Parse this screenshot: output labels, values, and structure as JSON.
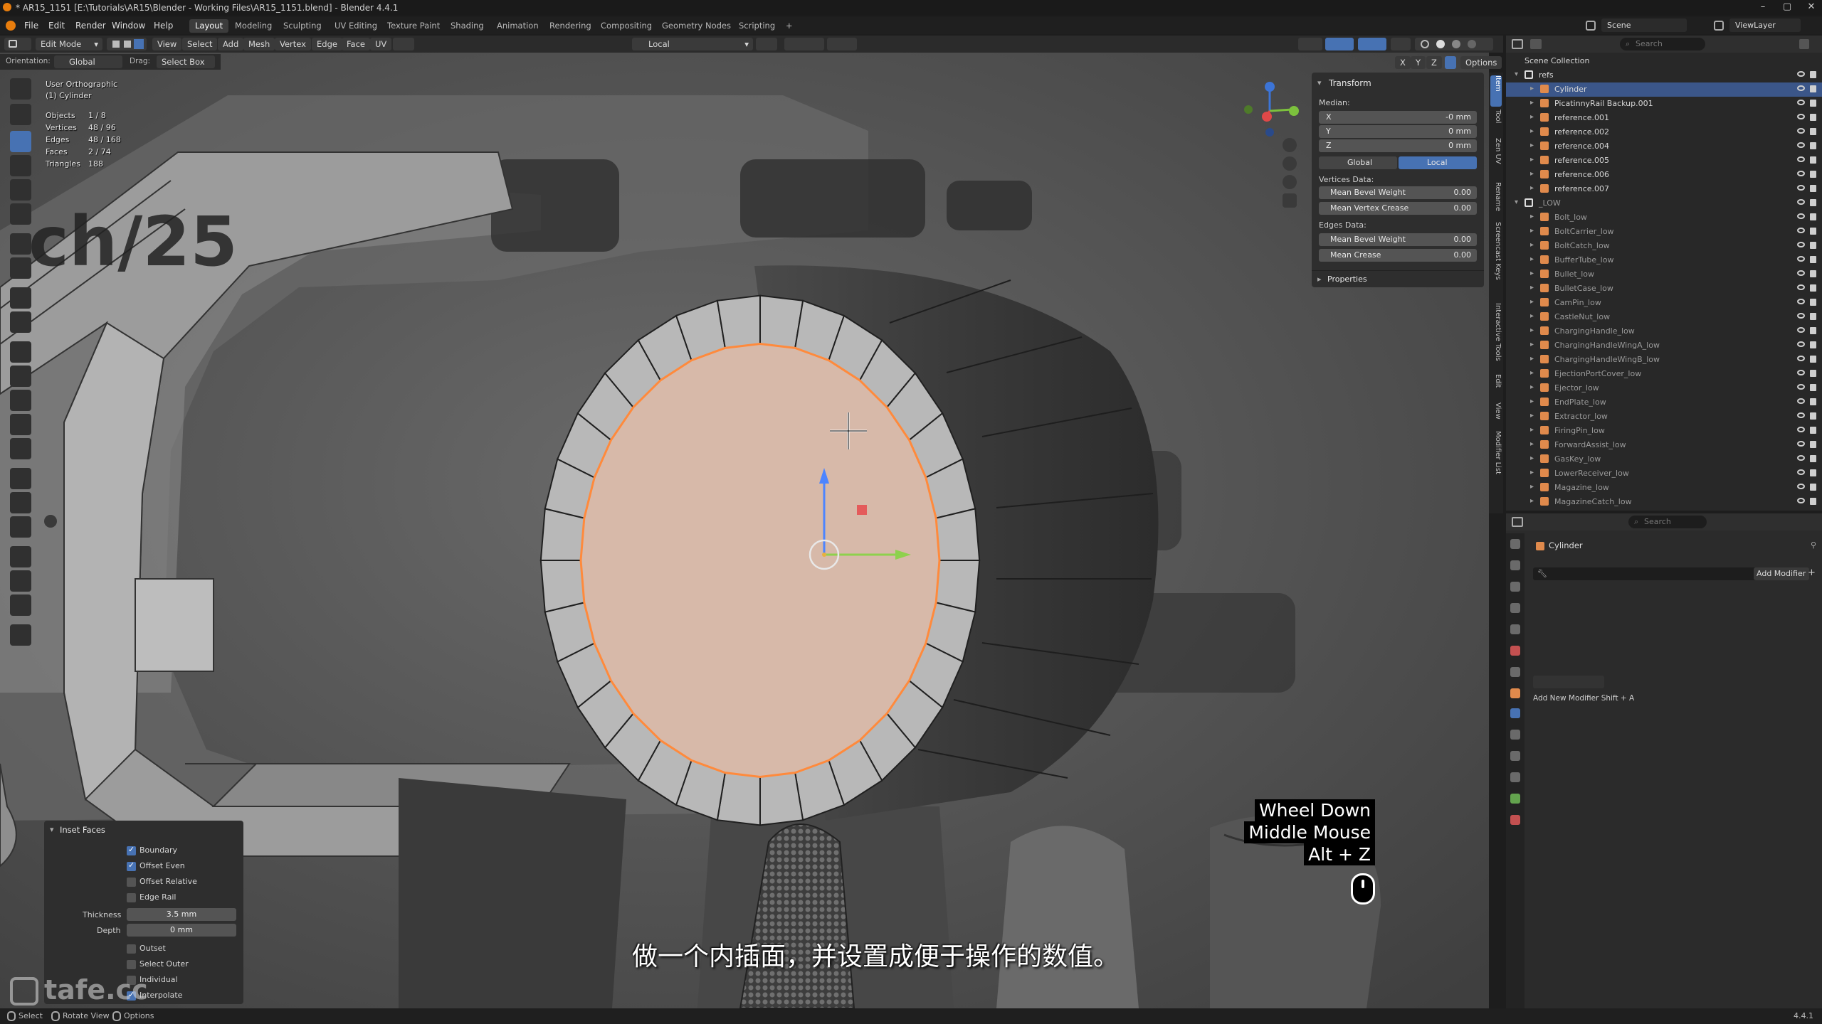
{
  "window": {
    "title": "* AR15_1151 [E:\\Tutorials\\AR15\\Blender - Working Files\\AR15_1151.blend] - Blender 4.4.1",
    "minimize": "–",
    "maximize": "▢",
    "close": "✕"
  },
  "menubar": {
    "items": [
      "File",
      "Edit",
      "Render",
      "Window",
      "Help"
    ],
    "workspaces": [
      "Layout",
      "Modeling",
      "Sculpting",
      "UV Editing",
      "Texture Paint",
      "Shading",
      "Animation",
      "Rendering",
      "Compositing",
      "Geometry Nodes",
      "Scripting",
      "+"
    ],
    "active_workspace": "Layout",
    "scene": "Scene",
    "view_layer": "ViewLayer"
  },
  "viewport_header": {
    "mode": "Edit Mode",
    "menus": [
      "View",
      "Select",
      "Add",
      "Mesh",
      "Vertex",
      "Edge",
      "Face",
      "UV"
    ],
    "transform_orientation": "Local",
    "orientation_label": "Orientation:",
    "orientation_value": "Global",
    "drag_label": "Drag:",
    "drag_value": "Select Box",
    "axes": [
      "X",
      "Y",
      "Z"
    ],
    "options": "Options"
  },
  "overlay": {
    "view_name": "User Orthographic",
    "object_name": "(1) Cylinder",
    "stats": [
      {
        "label": "Objects",
        "value": "1 / 8"
      },
      {
        "label": "Vertices",
        "value": "48 / 96"
      },
      {
        "label": "Edges",
        "value": "48 / 168"
      },
      {
        "label": "Faces",
        "value": "2 / 74"
      },
      {
        "label": "Triangles",
        "value": "188"
      }
    ]
  },
  "background_text": "ch/25",
  "npanel": {
    "header": "Transform",
    "median_label": "Median:",
    "x": {
      "label": "X",
      "value": "-0 mm"
    },
    "y": {
      "label": "Y",
      "value": "0 mm"
    },
    "z": {
      "label": "Z",
      "value": "0 mm"
    },
    "global_btn": "Global",
    "local_btn": "Local",
    "vertices_data": "Vertices Data:",
    "mean_bevel_weight_v": {
      "label": "Mean Bevel Weight",
      "value": "0.00"
    },
    "mean_vertex_crease": {
      "label": "Mean Vertex Crease",
      "value": "0.00"
    },
    "edges_data": "Edges Data:",
    "mean_bevel_weight_e": {
      "label": "Mean Bevel Weight",
      "value": "0.00"
    },
    "mean_crease": {
      "label": "Mean Crease",
      "value": "0.00"
    },
    "properties": "Properties"
  },
  "side_tabs": [
    "Item",
    "Tool",
    "Zen UV",
    "Rename",
    "Screencast Keys",
    "Interactive Tools",
    "Edit",
    "View",
    "Modifier List"
  ],
  "outliner": {
    "search_placeholder": "Search",
    "root": "Scene Collection",
    "collections": [
      {
        "name": "refs",
        "children": [
          "Cylinder",
          "PicatinnyRail Backup.001",
          "reference.001",
          "reference.002",
          "reference.004",
          "reference.005",
          "reference.006",
          "reference.007"
        ]
      },
      {
        "name": "_LOW",
        "children": [
          "Bolt_low",
          "BoltCarrier_low",
          "BoltCatch_low",
          "BufferTube_low",
          "Bullet_low",
          "BulletCase_low",
          "CamPin_low",
          "CastleNut_low",
          "ChargingHandle_low",
          "ChargingHandleWingA_low",
          "ChargingHandleWingB_low",
          "EjectionPortCover_low",
          "Ejector_low",
          "EndPlate_low",
          "Extractor_low",
          "FiringPin_low",
          "ForwardAssist_low",
          "GasKey_low",
          "LowerReceiver_low",
          "Magazine_low",
          "MagazineCatch_low"
        ]
      }
    ],
    "selected": "Cylinder"
  },
  "properties": {
    "search_placeholder": "Search",
    "object_name": "Cylinder",
    "add_modifier": "Add Modifier",
    "hint": "Add New Modifier Shift + A"
  },
  "inset_panel": {
    "title": "Inset Faces",
    "options": [
      {
        "label": "Boundary",
        "checked": true
      },
      {
        "label": "Offset Even",
        "checked": true
      },
      {
        "label": "Offset Relative",
        "checked": false
      },
      {
        "label": "Edge Rail",
        "checked": false
      }
    ],
    "thickness": {
      "label": "Thickness",
      "value": "3.5 mm"
    },
    "depth": {
      "label": "Depth",
      "value": "0 mm"
    },
    "options2": [
      {
        "label": "Outset",
        "checked": false
      },
      {
        "label": "Select Outer",
        "checked": false
      },
      {
        "label": "Individual",
        "checked": false
      },
      {
        "label": "Interpolate",
        "checked": true
      }
    ]
  },
  "keys_overlay": [
    "Wheel Down",
    "Middle Mouse",
    "Alt + Z"
  ],
  "subtitle": "做一个内插面，并设置成便于操作的数值。",
  "watermark": "tafe.cc",
  "statusbar": {
    "items": [
      "Select",
      "Rotate View",
      "Options"
    ],
    "version": "4.4.1"
  },
  "colors": {
    "accent": "#4772b3",
    "selected_face": "#d7b9a9",
    "selected_edge": "#ff8a3c",
    "viewport_bg": "#575757"
  }
}
